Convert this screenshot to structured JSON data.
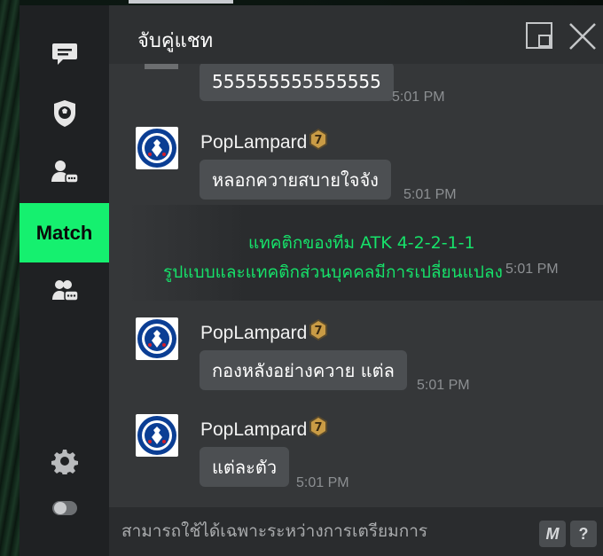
{
  "window": {
    "title": "จับคู่แชท",
    "accent_color": "#15f06f"
  },
  "sidebar": {
    "items": [
      {
        "icon": "chat-bubble-icon"
      },
      {
        "icon": "team-shield-icon"
      },
      {
        "icon": "user-chat-icon"
      },
      {
        "label": "Match"
      },
      {
        "icon": "group-chat-icon"
      }
    ],
    "bottom": [
      {
        "icon": "gear-icon"
      },
      {
        "icon": "toggle-icon"
      }
    ]
  },
  "messages": [
    {
      "bubble": "555555555555555",
      "time": "5:01 PM"
    },
    {
      "user": "PopLampard",
      "bubble": "หลอกควายสบายใจจัง",
      "time": "5:01 PM"
    },
    {
      "system_line1": "แทคติกของทีม ATK 4-2-2-1-1",
      "system_line2": "รูปแบบและแทคติกส่วนบุคคลมีการเปลี่ยนแปลง",
      "time": "5:01 PM"
    },
    {
      "user": "PopLampard",
      "bubble": "กองหลังอย่างควาย แต่ล",
      "time": "5:01 PM"
    },
    {
      "user": "PopLampard",
      "bubble": "แต่ละตัว",
      "time": "5:01 PM"
    }
  ],
  "footer": {
    "placeholder": "สามารถใช้ได้เฉพาะระหว่างการเตรียมการ",
    "macro_button": "M",
    "help_button": "?"
  }
}
